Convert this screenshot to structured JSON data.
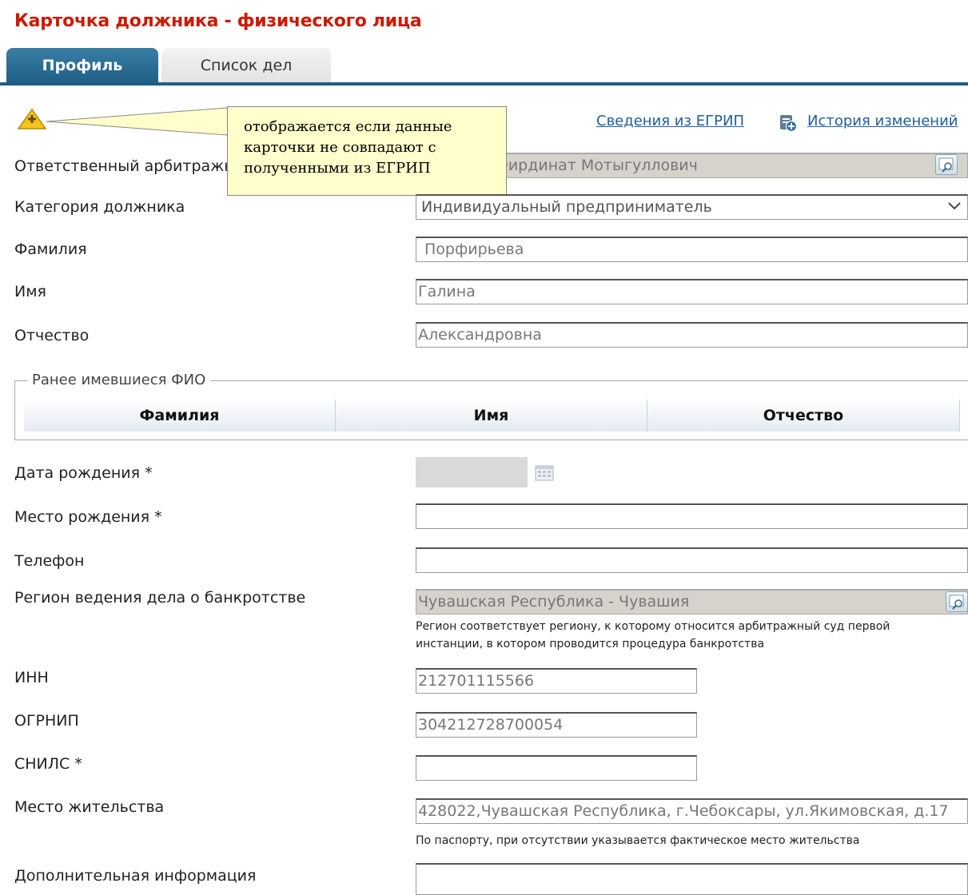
{
  "page": {
    "title": "Карточка должника - физического лица"
  },
  "tabs": [
    {
      "label": "Профиль",
      "active": true
    },
    {
      "label": "Список дел",
      "active": false
    }
  ],
  "callout": {
    "text_lines": [
      "отображается если данные",
      "карточки не совпадают с",
      "полученными из ЕГРИП"
    ]
  },
  "links": {
    "egrip": "Сведения из ЕГРИП",
    "history": "История изменений"
  },
  "form": {
    "manager": {
      "label": "Ответственный арбитражный управляющий",
      "label_visible": "Ответственный арбитражн",
      "value": "н Фирдинат Мотыгуллович"
    },
    "category": {
      "label": "Категория должника",
      "value": "Индивидуальный предприниматель"
    },
    "last_name": {
      "label": "Фамилия",
      "value": "Порфирьева"
    },
    "first_name": {
      "label": "Имя",
      "value": "Галина"
    },
    "patronymic": {
      "label": "Отчество",
      "value": "Александровна"
    },
    "previous_names": {
      "legend": "Ранее имевшиеся ФИО",
      "columns": [
        "Фамилия",
        "Имя",
        "Отчество"
      ]
    },
    "birth_date": {
      "label": "Дата рождения *",
      "value": ""
    },
    "birth_place": {
      "label": "Место рождения *",
      "value": ""
    },
    "phone": {
      "label": "Телефон",
      "value": ""
    },
    "region": {
      "label": "Регион ведения дела о банкротстве",
      "value": "Чувашская Республика - Чувашия",
      "hint_lines": [
        "Регион соответствует региону, к которому относится арбитражный суд первой",
        "инстанции, в котором проводится процедура банкротства"
      ]
    },
    "inn": {
      "label": "ИНН",
      "value": "212701115566"
    },
    "ogrnip": {
      "label": "ОГРНИП",
      "value": "304212728700054"
    },
    "snils": {
      "label": "СНИЛС *",
      "value": ""
    },
    "residence": {
      "label": "Место жительства",
      "value": "428022,Чувашская Республика, г.Чебоксары, ул.Якимовская, д.17",
      "hint": "По паспорту, при отсутствии указывается фактическое место жительства"
    },
    "additional_info": {
      "label": "Дополнительная информация",
      "value": ""
    }
  },
  "icons": {
    "warning": "warning-triangle-icon",
    "lookup": "lookup-magnifier-icon",
    "calendar": "calendar-icon",
    "history": "history-icon",
    "dropdown": "chevron-down-icon"
  },
  "colors": {
    "title": "#cc1a00",
    "tab_active": "#1f5e84",
    "link": "#1f5e9e",
    "callout_bg": "#ffffcc",
    "readonly_bg": "#d6d3cc"
  }
}
